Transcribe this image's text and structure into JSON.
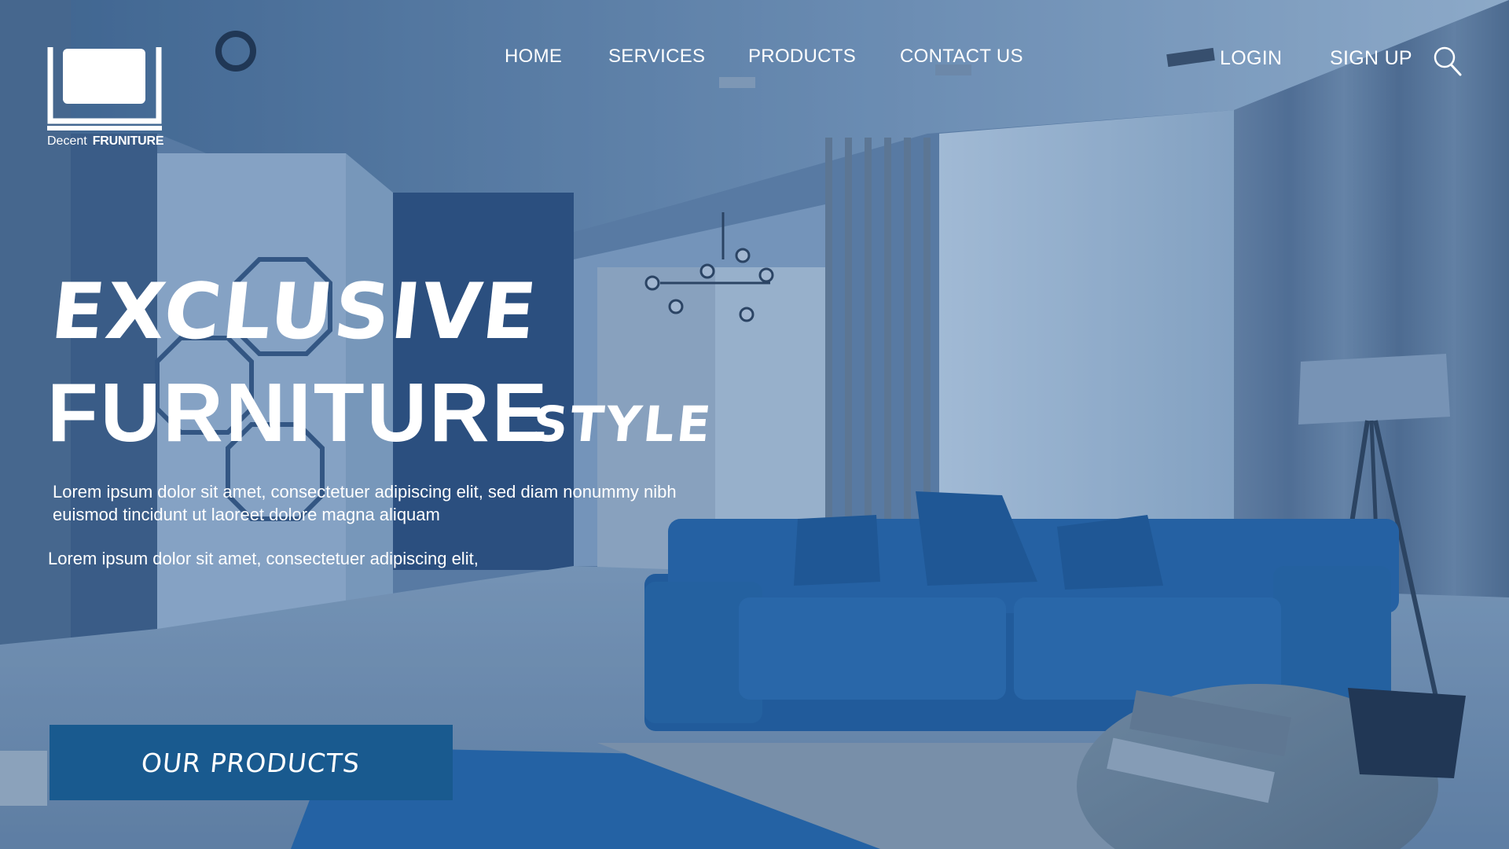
{
  "brand": {
    "word1": "Decent",
    "word2": "FRUNITURE"
  },
  "nav": {
    "items": [
      {
        "label": "HOME"
      },
      {
        "label": "SERVICES"
      },
      {
        "label": "PRODUCTS"
      },
      {
        "label": "CONTACT US"
      }
    ],
    "login": "LOGIN",
    "signup": "SIGN UP",
    "search_icon": "search-icon"
  },
  "hero": {
    "line1": "EXCLUSIVE",
    "line2": "FURNITURE",
    "line2_suffix": "STYLE",
    "description": "Lorem ipsum dolor sit amet, consectetuer adipiscing elit, sed diam nonummy nibh euismod tincidunt ut laoreet dolore magna aliquam",
    "description2": "Lorem ipsum dolor sit amet, consectetuer adipiscing elit,",
    "cta_label": "OUR PRODUCTS"
  },
  "colors": {
    "overlay": "#2f5a8c",
    "sofa": "#1f5d9e",
    "cta": "#195a8f",
    "text": "#ffffff"
  }
}
